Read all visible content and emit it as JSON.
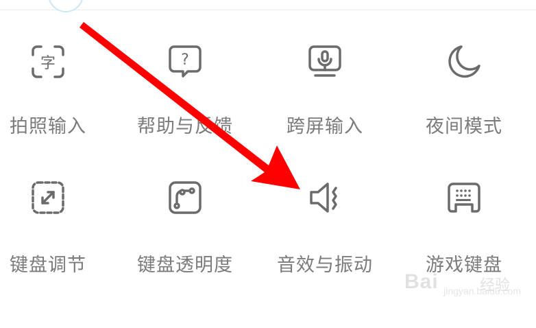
{
  "grid": {
    "items": [
      {
        "label": "拍照输入",
        "icon": "camera-text-icon"
      },
      {
        "label": "帮助与反馈",
        "icon": "help-feedback-icon"
      },
      {
        "label": "跨屏输入",
        "icon": "cross-screen-input-icon"
      },
      {
        "label": "夜间模式",
        "icon": "moon-icon"
      },
      {
        "label": "键盘调节",
        "icon": "keyboard-resize-icon"
      },
      {
        "label": "键盘透明度",
        "icon": "keyboard-transparency-icon"
      },
      {
        "label": "音效与振动",
        "icon": "sound-vibration-icon"
      },
      {
        "label": "游戏键盘",
        "icon": "game-keyboard-icon"
      }
    ]
  },
  "watermark": {
    "brand": "Bai",
    "suffix": "经验",
    "url": "jingyan.baidu.com"
  },
  "colors": {
    "icon_stroke": "#6b6b6b",
    "label_text": "#7b7b7b",
    "arrow": "#ff0000"
  }
}
